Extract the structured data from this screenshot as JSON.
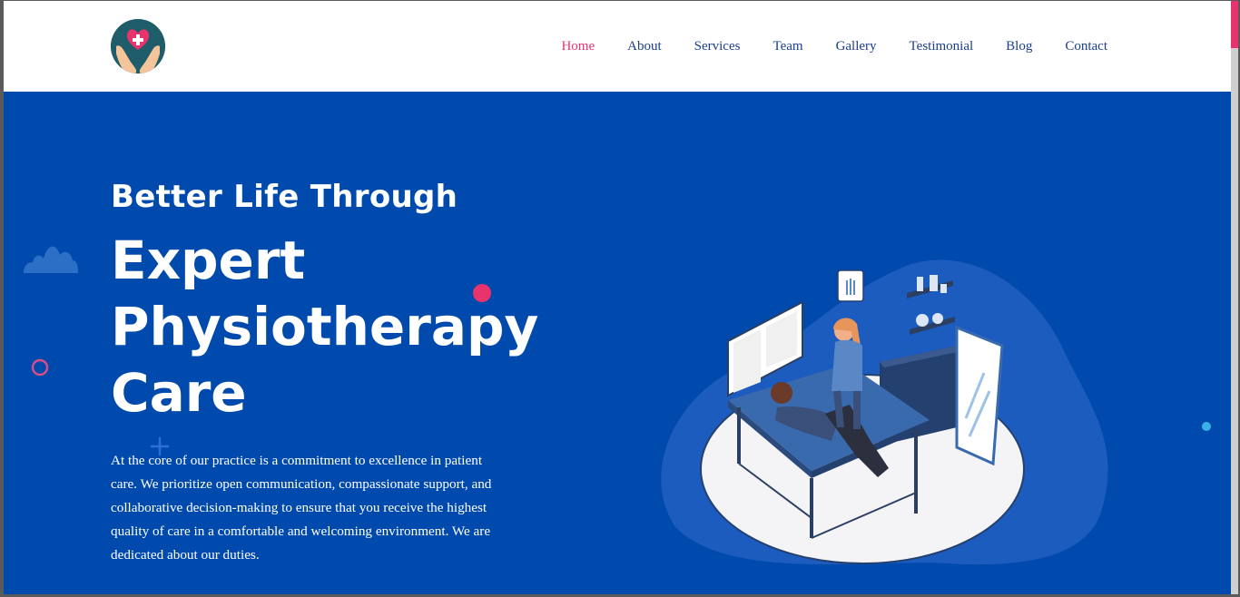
{
  "nav": {
    "items": [
      {
        "label": "Home",
        "active": true
      },
      {
        "label": "About",
        "active": false
      },
      {
        "label": "Services",
        "active": false
      },
      {
        "label": "Team",
        "active": false
      },
      {
        "label": "Gallery",
        "active": false
      },
      {
        "label": "Testimonial",
        "active": false
      },
      {
        "label": "Blog",
        "active": false
      },
      {
        "label": "Contact",
        "active": false
      }
    ]
  },
  "hero": {
    "subtitle": "Better Life Through",
    "title_lines": [
      "Expert",
      "Physiotherapy",
      "Care"
    ],
    "description": "At the core of our practice is a commitment to excellence in patient care. We prioritize open communication, compassionate support, and collaborative decision-making to ensure that you receive the highest quality of care in a comfortable and welcoming environment. We are dedicated about our duties."
  },
  "icons": {
    "logo": "heart-hands-icon",
    "illustration": "physiotherapy-session-illustration"
  },
  "colors": {
    "primary_blue": "#004aad",
    "accent_pink": "#e8336d",
    "nav_text": "#1a3e8c",
    "white": "#ffffff"
  }
}
